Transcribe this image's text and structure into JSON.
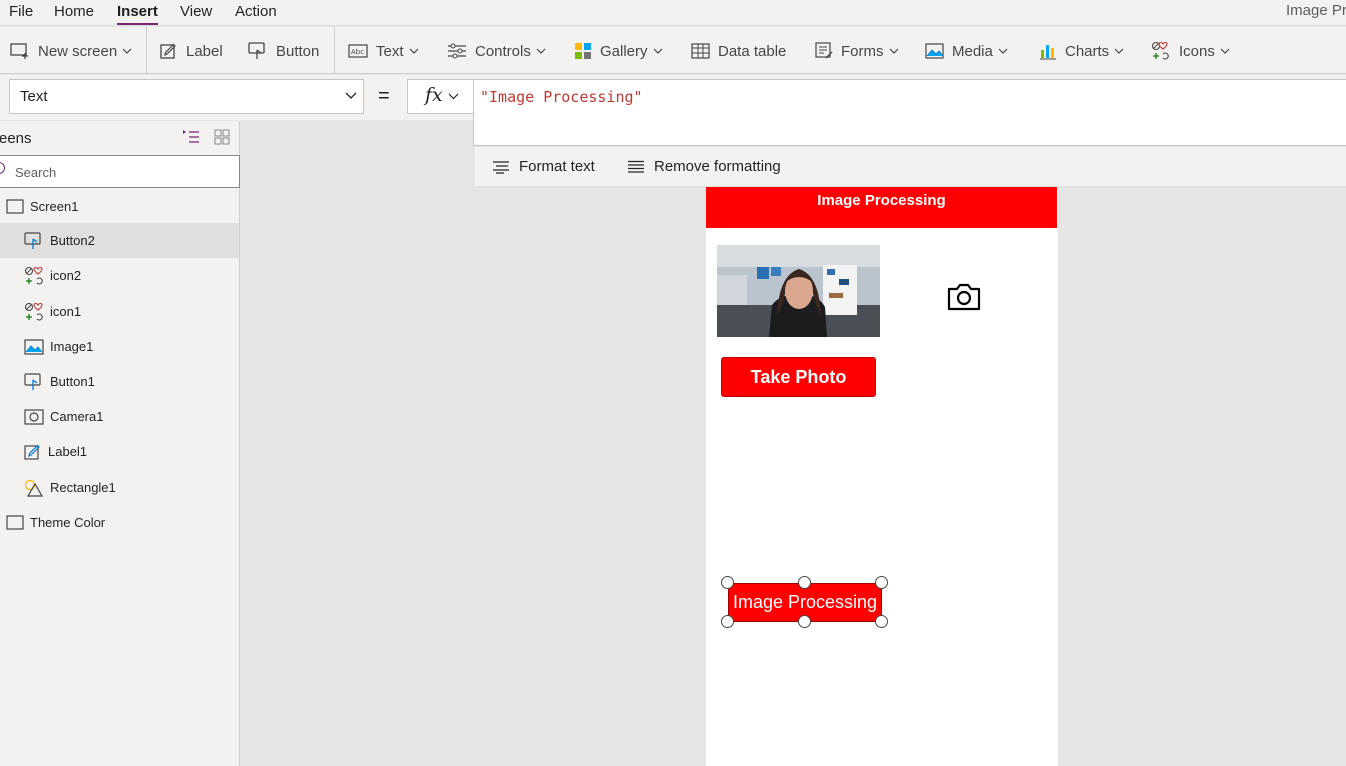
{
  "menu": {
    "items": [
      "File",
      "Home",
      "Insert",
      "View",
      "Action"
    ],
    "active": "Insert",
    "app_title": "Image Pr"
  },
  "ribbon": {
    "new_screen": "New screen",
    "label": "Label",
    "button": "Button",
    "text": "Text",
    "controls": "Controls",
    "gallery": "Gallery",
    "data_table": "Data table",
    "forms": "Forms",
    "media": "Media",
    "charts": "Charts",
    "icons": "Icons"
  },
  "formula_bar": {
    "property": "Text",
    "equals": "=",
    "fx": "fx",
    "formula": "\"Image Processing\"",
    "format_text": "Format text",
    "remove_formatting": "Remove formatting"
  },
  "tree": {
    "title": "reens",
    "search_placeholder": "Search",
    "nodes": [
      {
        "label": "Screen1",
        "icon": "screen-icon"
      },
      {
        "label": "Button2",
        "icon": "button-icon",
        "selected": true
      },
      {
        "label": "icon2",
        "icon": "icons-icon"
      },
      {
        "label": "icon1",
        "icon": "icons-icon"
      },
      {
        "label": "Image1",
        "icon": "image-icon"
      },
      {
        "label": "Button1",
        "icon": "button-icon"
      },
      {
        "label": "Camera1",
        "icon": "camera-icon"
      },
      {
        "label": "Label1",
        "icon": "label-icon"
      },
      {
        "label": "Rectangle1",
        "icon": "shapes-icon"
      },
      {
        "label": "Theme Color",
        "icon": "screen-icon"
      }
    ]
  },
  "app_screen": {
    "title": "Image Processing",
    "take_photo_label": "Take Photo",
    "image_processing_label": "Image Processing"
  },
  "colors": {
    "accent": "#742774",
    "app_red": "#ff0000"
  }
}
